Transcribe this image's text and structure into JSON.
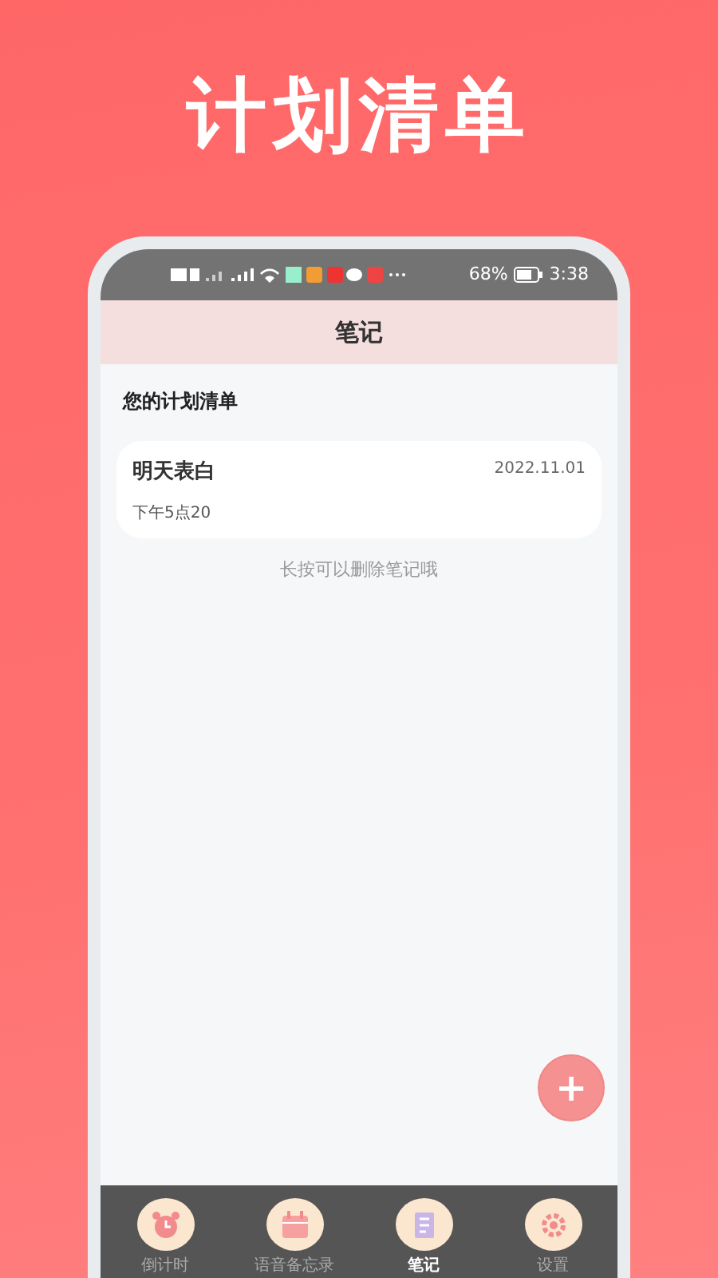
{
  "promo_title": "计划清单",
  "status_bar": {
    "battery": "68%",
    "time": "3:38"
  },
  "header": {
    "title": "笔记"
  },
  "section_title": "您的计划清单",
  "notes": [
    {
      "title": "明天表白",
      "date": "2022.11.01",
      "time": "下午5点20"
    }
  ],
  "hint": "长按可以删除笔记哦",
  "fab": {
    "label": "+"
  },
  "tabs": [
    {
      "label": "倒计时",
      "kind": "alarm",
      "selected": false
    },
    {
      "label": "语音备忘录",
      "kind": "calendar",
      "selected": false
    },
    {
      "label": "笔记",
      "kind": "note",
      "selected": true
    },
    {
      "label": "设置",
      "kind": "gear",
      "selected": false
    }
  ]
}
